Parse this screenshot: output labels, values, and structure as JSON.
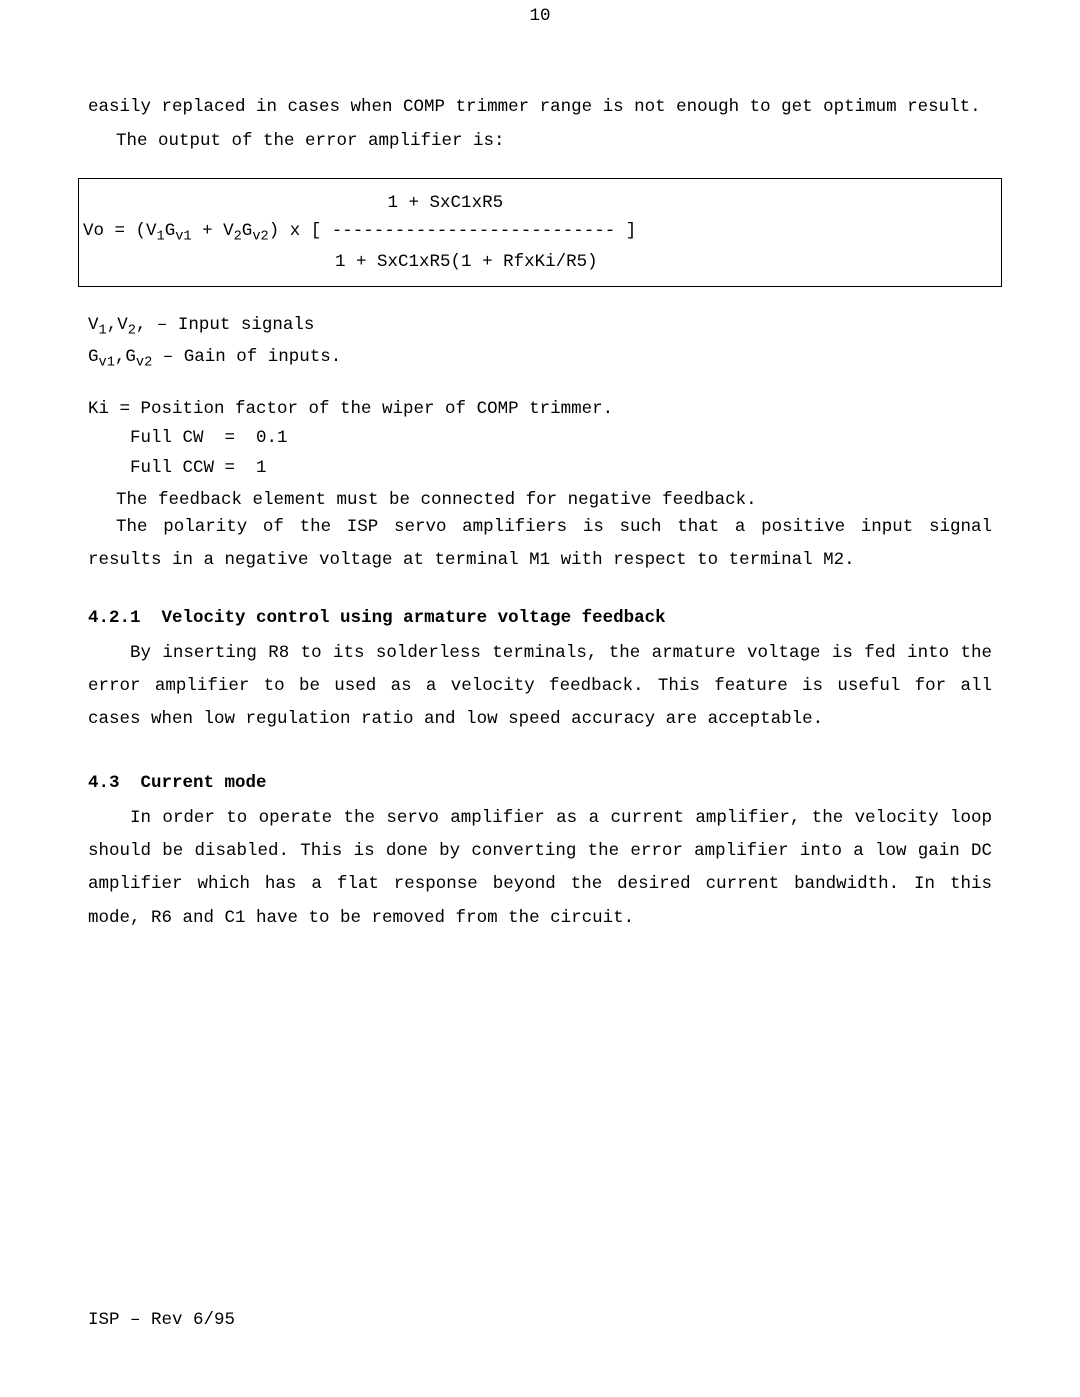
{
  "page_number": "10",
  "para_lead": "easily replaced in cases when COMP trimmer range is not enough to get optimum result.",
  "para_output": "The output of the error amplifier is:",
  "formula": {
    "numerator_line": "                             1 + SxC1xR5",
    "main_line_prefix": "Vo = (V",
    "sub1": "1",
    "g": "G",
    "subv1": "v1",
    "plus": " + V",
    "sub2": "2",
    "subv2": "v2",
    "main_line_suffix": ") x [ --------------------------- ]",
    "denominator_line": "                        1 + SxC1xR5(1 + RfxKi/R5)"
  },
  "signals_line_prefix": "V",
  "signals_sub1": "1",
  "signals_comma": ",V",
  "signals_sub2": "2",
  "signals_suffix": ", – Input signals",
  "gains_prefix": "G",
  "gains_subv1": "v1",
  "gains_comma": ",G",
  "gains_subv2": "v2",
  "gains_suffix": "  – Gain of inputs.",
  "ki_line": "Ki = Position factor of the wiper of COMP trimmer.",
  "ki_cw": "    Full CW  =  0.1",
  "ki_ccw": "    Full CCW =  1",
  "feedback_line": "The feedback element must be connected for negative feedback.",
  "polarity_para": "The polarity of the ISP servo amplifiers is such that a positive input signal results in a negative voltage at terminal M1 with respect to terminal M2.",
  "s421_num": "4.2.1",
  "s421_title": "Velocity control using armature voltage feedback",
  "s421_body": "By inserting R8 to its solderless terminals, the armature voltage is fed into the error amplifier to be used as a velocity feedback. This feature is useful for all cases when low regulation ratio and low speed accuracy are acceptable.",
  "s43_num": "4.3",
  "s43_title": "Current mode",
  "s43_body": "In order to operate the servo amplifier as a current amplifier, the velocity loop should be disabled. This is done by converting the error amplifier into a low gain DC amplifier which has a flat response beyond the desired current bandwidth. In this mode, R6 and C1 have to be removed from the circuit.",
  "footer": "ISP – Rev 6/95"
}
